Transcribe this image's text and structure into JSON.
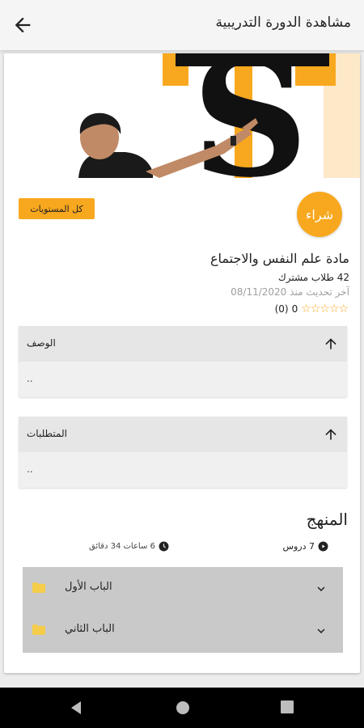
{
  "appbar": {
    "title": "مشاهدة الدورة التدريبية"
  },
  "course": {
    "buy_label": "شراء",
    "levels_label": "كل المستويات",
    "title": "مادة علم النفس والاجتماع",
    "students": "42 طلاب مشترك",
    "updated": "آخر تحديث منذ 08/11/2020",
    "rating_value": "0",
    "rating_count": "(0)",
    "stars": "☆☆☆☆☆"
  },
  "description": {
    "label": "الوصف",
    "body": ".."
  },
  "requirements": {
    "label": "المتطلبات",
    "body": ".."
  },
  "curriculum": {
    "title": "المنهج",
    "lessons": "7 دروس",
    "duration": "6 ساعات 34 دقائق",
    "chapters": [
      {
        "name": "الباب الأول"
      },
      {
        "name": "الباب الثاني"
      }
    ]
  },
  "colors": {
    "accent": "#f8a81e",
    "folder": "#f5cd4a"
  },
  "icons": [
    "arrow-back-icon",
    "arrow-up-icon",
    "play-circle-icon",
    "clock-icon",
    "chevron-down-icon",
    "folder-icon"
  ]
}
